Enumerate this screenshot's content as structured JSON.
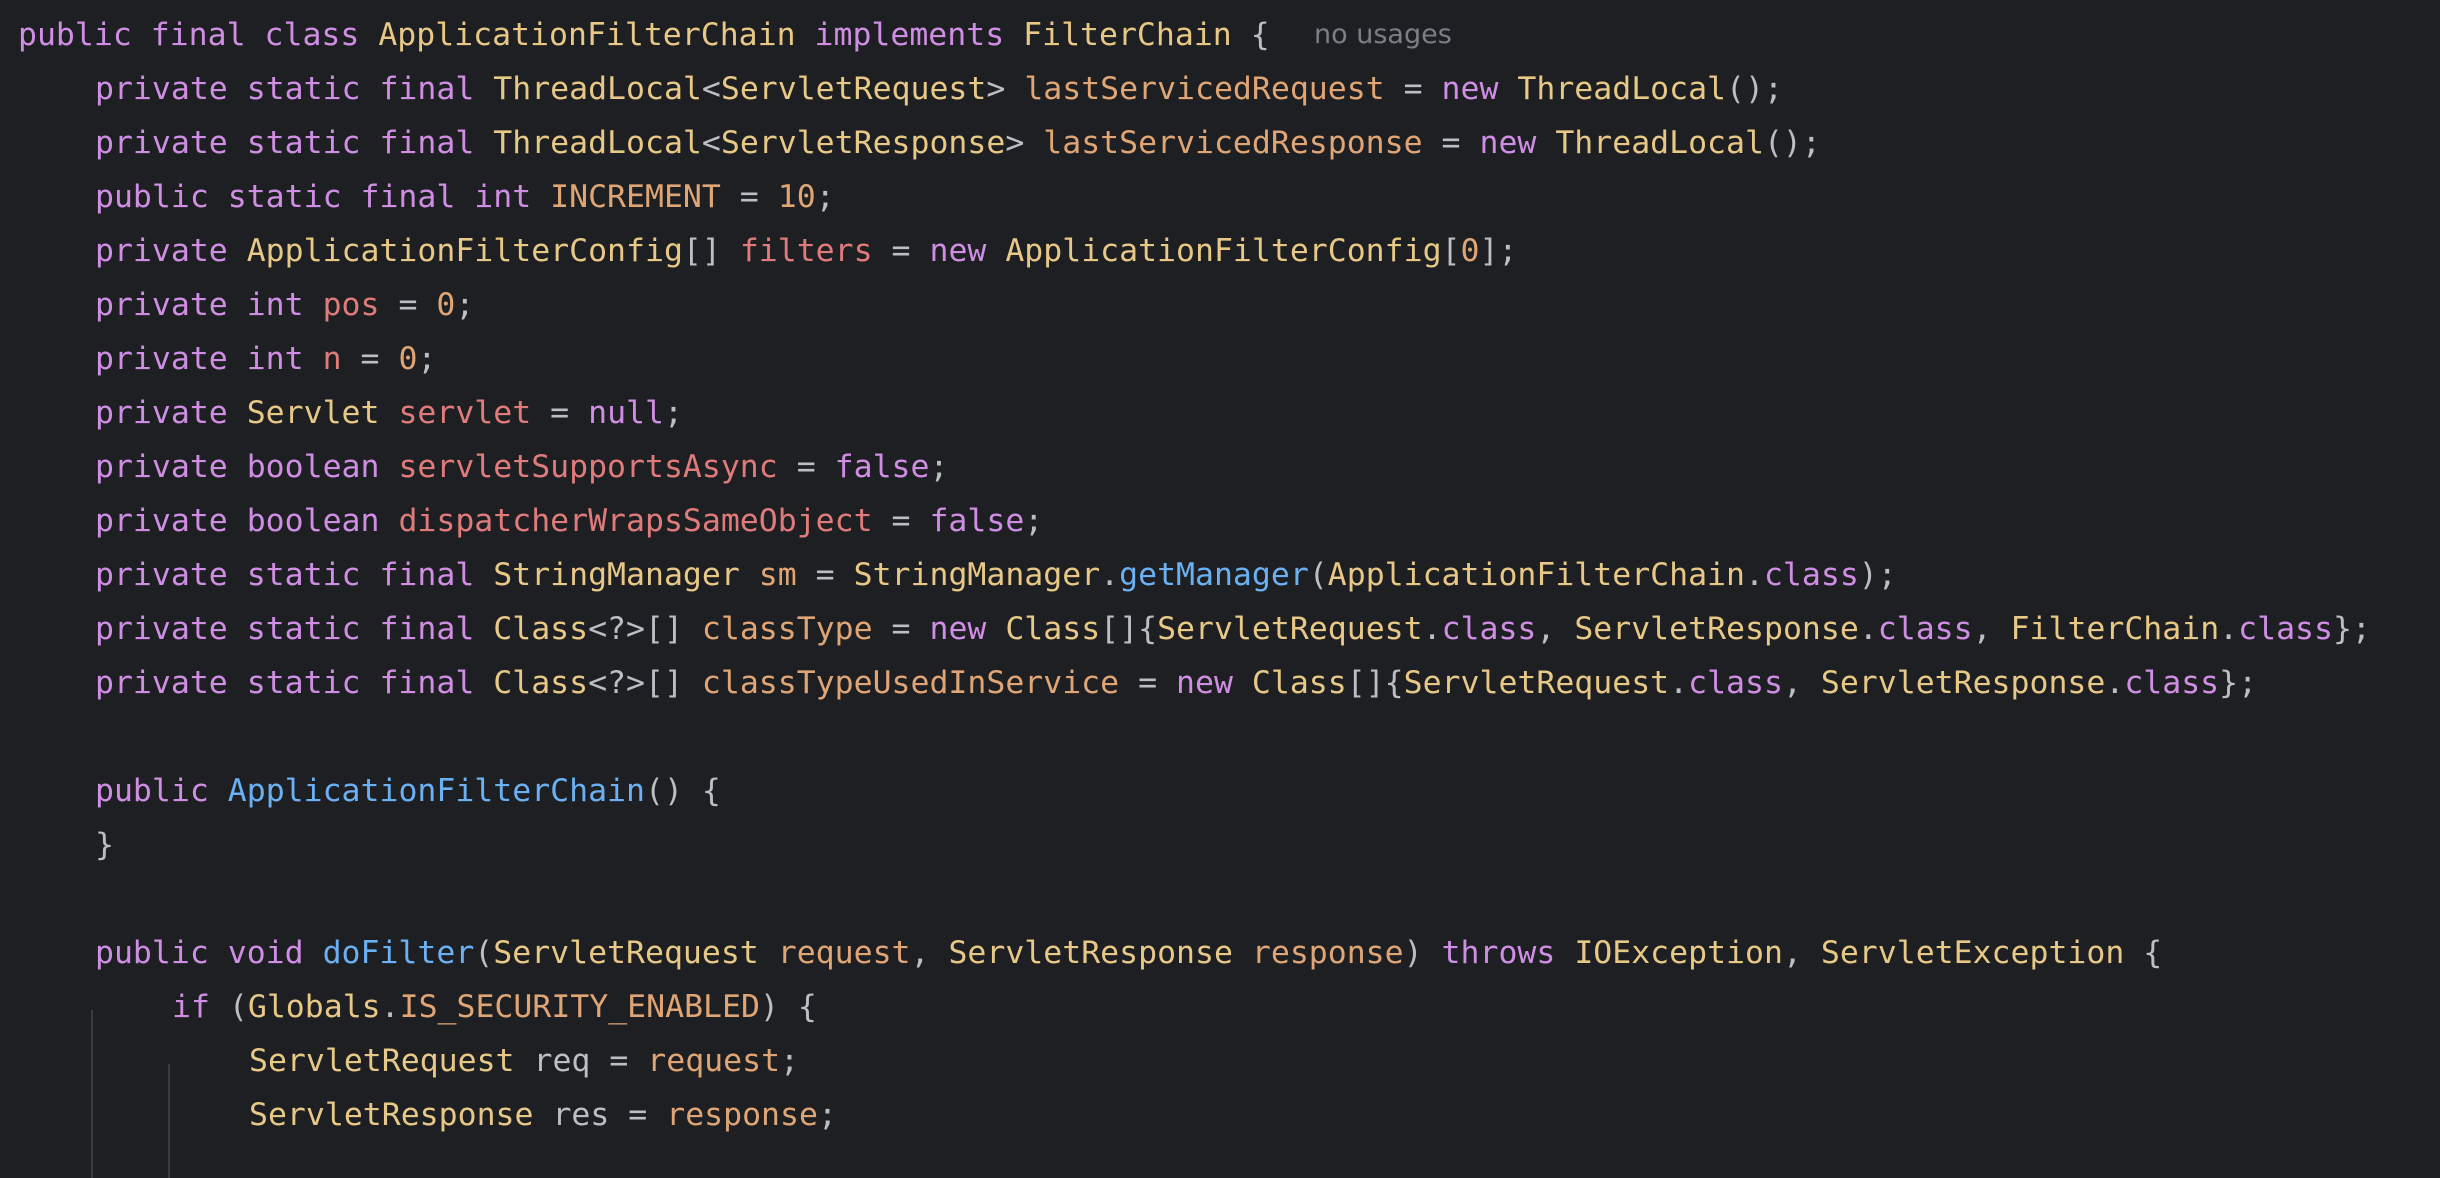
{
  "editor": {
    "language": "java",
    "inlay_hint": "no usages",
    "lines": [
      [
        [
          "k",
          "public final class "
        ],
        [
          "t",
          "ApplicationFilterChain "
        ],
        [
          "k",
          "implements "
        ],
        [
          "t",
          "FilterChain "
        ],
        [
          "p",
          "{  "
        ]
      ],
      [
        [
          "k",
          "private static final "
        ],
        [
          "t",
          "ThreadLocal"
        ],
        [
          "p",
          "<"
        ],
        [
          "t",
          "ServletRequest"
        ],
        [
          "p",
          "> "
        ],
        [
          "f",
          "lastServicedRequest"
        ],
        [
          "p",
          " = "
        ],
        [
          "k",
          "new "
        ],
        [
          "t",
          "ThreadLocal"
        ],
        [
          "p",
          "();"
        ]
      ],
      [
        [
          "k",
          "private static final "
        ],
        [
          "t",
          "ThreadLocal"
        ],
        [
          "p",
          "<"
        ],
        [
          "t",
          "ServletResponse"
        ],
        [
          "p",
          "> "
        ],
        [
          "f",
          "lastServicedResponse"
        ],
        [
          "p",
          " = "
        ],
        [
          "k",
          "new "
        ],
        [
          "t",
          "ThreadLocal"
        ],
        [
          "p",
          "();"
        ]
      ],
      [
        [
          "k",
          "public static final int "
        ],
        [
          "c",
          "INCREMENT"
        ],
        [
          "p",
          " = "
        ],
        [
          "n",
          "10"
        ],
        [
          "p",
          ";"
        ]
      ],
      [
        [
          "k",
          "private "
        ],
        [
          "t",
          "ApplicationFilterConfig"
        ],
        [
          "p",
          "[] "
        ],
        [
          "pf",
          "filters"
        ],
        [
          "p",
          " = "
        ],
        [
          "k",
          "new "
        ],
        [
          "t",
          "ApplicationFilterConfig"
        ],
        [
          "p",
          "["
        ],
        [
          "n",
          "0"
        ],
        [
          "p",
          "];"
        ]
      ],
      [
        [
          "k",
          "private int "
        ],
        [
          "pf",
          "pos"
        ],
        [
          "p",
          " = "
        ],
        [
          "n",
          "0"
        ],
        [
          "p",
          ";"
        ]
      ],
      [
        [
          "k",
          "private int "
        ],
        [
          "pf",
          "n"
        ],
        [
          "p",
          " = "
        ],
        [
          "n",
          "0"
        ],
        [
          "p",
          ";"
        ]
      ],
      [
        [
          "k",
          "private "
        ],
        [
          "t",
          "Servlet "
        ],
        [
          "pf",
          "servlet"
        ],
        [
          "p",
          " = "
        ],
        [
          "k",
          "null"
        ],
        [
          "p",
          ";"
        ]
      ],
      [
        [
          "k",
          "private boolean "
        ],
        [
          "pf",
          "servletSupportsAsync"
        ],
        [
          "p",
          " = "
        ],
        [
          "k",
          "false"
        ],
        [
          "p",
          ";"
        ]
      ],
      [
        [
          "k",
          "private boolean "
        ],
        [
          "pf",
          "dispatcherWrapsSameObject"
        ],
        [
          "p",
          " = "
        ],
        [
          "k",
          "false"
        ],
        [
          "p",
          ";"
        ]
      ],
      [
        [
          "k",
          "private static final "
        ],
        [
          "t",
          "StringManager "
        ],
        [
          "f",
          "sm"
        ],
        [
          "p",
          " = "
        ],
        [
          "t",
          "StringManager"
        ],
        [
          "p",
          "."
        ],
        [
          "m",
          "getManager"
        ],
        [
          "p",
          "("
        ],
        [
          "t",
          "ApplicationFilterChain"
        ],
        [
          "p",
          "."
        ],
        [
          "k",
          "class"
        ],
        [
          "p",
          ");"
        ]
      ],
      [
        [
          "k",
          "private static final "
        ],
        [
          "t",
          "Class"
        ],
        [
          "p",
          "<?>[] "
        ],
        [
          "f",
          "classType"
        ],
        [
          "p",
          " = "
        ],
        [
          "k",
          "new "
        ],
        [
          "t",
          "Class"
        ],
        [
          "p",
          "[]{"
        ],
        [
          "t",
          "ServletRequest"
        ],
        [
          "p",
          "."
        ],
        [
          "k",
          "class"
        ],
        [
          "p",
          ", "
        ],
        [
          "t",
          "ServletResponse"
        ],
        [
          "p",
          "."
        ],
        [
          "k",
          "class"
        ],
        [
          "p",
          ", "
        ],
        [
          "t",
          "FilterChain"
        ],
        [
          "p",
          "."
        ],
        [
          "k",
          "class"
        ],
        [
          "p",
          "};"
        ]
      ],
      [
        [
          "k",
          "private static final "
        ],
        [
          "t",
          "Class"
        ],
        [
          "p",
          "<?>[] "
        ],
        [
          "f",
          "classTypeUsedInService"
        ],
        [
          "p",
          " = "
        ],
        [
          "k",
          "new "
        ],
        [
          "t",
          "Class"
        ],
        [
          "p",
          "[]{"
        ],
        [
          "t",
          "ServletRequest"
        ],
        [
          "p",
          "."
        ],
        [
          "k",
          "class"
        ],
        [
          "p",
          ", "
        ],
        [
          "t",
          "ServletResponse"
        ],
        [
          "p",
          "."
        ],
        [
          "k",
          "class"
        ],
        [
          "p",
          "};"
        ]
      ],
      [],
      [
        [
          "k",
          "public "
        ],
        [
          "m",
          "ApplicationFilterChain"
        ],
        [
          "p",
          "() {"
        ]
      ],
      [
        [
          "p",
          "}"
        ]
      ],
      [],
      [
        [
          "k",
          "public void "
        ],
        [
          "m",
          "doFilter"
        ],
        [
          "p",
          "("
        ],
        [
          "t",
          "ServletRequest "
        ],
        [
          "f",
          "request"
        ],
        [
          "p",
          ", "
        ],
        [
          "t",
          "ServletResponse "
        ],
        [
          "f",
          "response"
        ],
        [
          "p",
          ") "
        ],
        [
          "k",
          "throws "
        ],
        [
          "t",
          "IOException"
        ],
        [
          "p",
          ", "
        ],
        [
          "t",
          "ServletException "
        ],
        [
          "p",
          "{"
        ]
      ],
      [
        [
          "k",
          "if "
        ],
        [
          "p",
          "("
        ],
        [
          "t",
          "Globals"
        ],
        [
          "p",
          "."
        ],
        [
          "c",
          "IS_SECURITY_ENABLED"
        ],
        [
          "p",
          ") {"
        ]
      ],
      [
        [
          "t",
          "ServletRequest "
        ],
        [
          "p",
          "req = "
        ],
        [
          "f",
          "request"
        ],
        [
          "p",
          ";"
        ]
      ],
      [
        [
          "t",
          "ServletResponse "
        ],
        [
          "p",
          "res = "
        ],
        [
          "f",
          "response"
        ],
        [
          "p",
          ";"
        ]
      ],
      []
    ]
  }
}
